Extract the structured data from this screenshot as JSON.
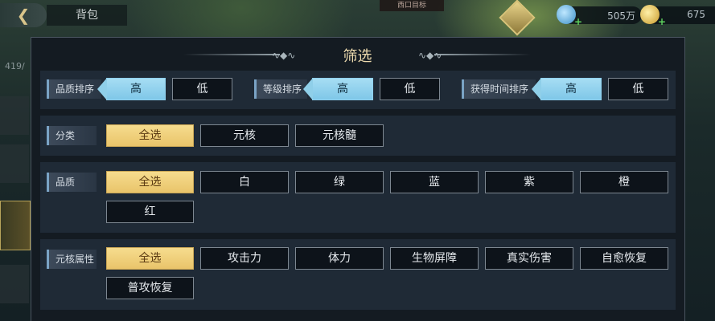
{
  "top": {
    "back_icon": "back-arrow-icon",
    "bag_title": "背包",
    "map_label": "西口目标",
    "gem_amount": "505万",
    "gold_amount": "675",
    "side_count": "419/"
  },
  "panel": {
    "title": "筛选",
    "sort": {
      "quality": {
        "label": "品质排序",
        "high": "高",
        "low": "低"
      },
      "level": {
        "label": "等级排序",
        "high": "高",
        "low": "低"
      },
      "time": {
        "label": "获得时间排序",
        "high": "高",
        "low": "低"
      }
    },
    "category": {
      "label": "分类",
      "options": [
        "全选",
        "元核",
        "元核髓"
      ]
    },
    "quality": {
      "label": "品质",
      "options": [
        "全选",
        "白",
        "绿",
        "蓝",
        "紫",
        "橙",
        "红"
      ]
    },
    "attribute": {
      "label": "元核属性",
      "options": [
        "全选",
        "攻击力",
        "体力",
        "生物屏障",
        "真实伤害",
        "自愈恢复",
        "普攻恢复"
      ]
    }
  },
  "colors": {
    "selected_gold": "#e9c46a",
    "selected_blue": "#7fc7e8",
    "panel_bg": "#141b22",
    "row_bg": "#1f2a36"
  }
}
